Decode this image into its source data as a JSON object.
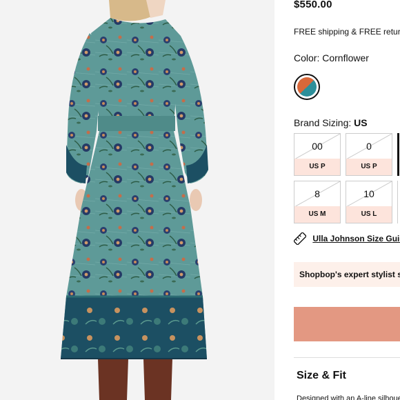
{
  "product": {
    "price": "$550.00",
    "shipping_text": "FREE shipping & FREE returns",
    "color_label": "Color:",
    "color_value": "Cornflower",
    "swatch_colors": [
      "#d8683a",
      "#2c8f9a"
    ],
    "sizing_label": "Brand Sizing:",
    "sizing_value": "US",
    "sizes": [
      {
        "number": "00",
        "label": "US P"
      },
      {
        "number": "0",
        "label": "US P"
      },
      {
        "number": "8",
        "label": "US M"
      },
      {
        "number": "10",
        "label": "US L"
      }
    ],
    "size_guide_text": "Ulla Johnson Size Guide",
    "stylist_text": "Shopbop's expert stylist says",
    "size_fit_title": "Size & Fit",
    "size_fit_text": "Designed with an A-line silhouette"
  },
  "colors": {
    "accent_button": "#e39882",
    "size_label_bg": "#fde4dc",
    "stylist_bg": "#fdf0ea",
    "dress_teal": "#5e9a98",
    "dress_border": "#1c4f63"
  }
}
